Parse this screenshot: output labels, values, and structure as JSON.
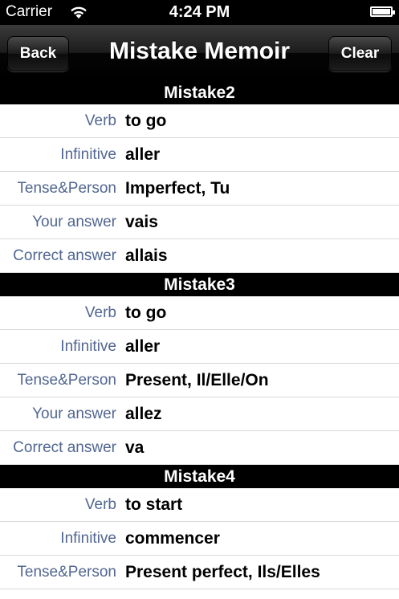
{
  "status_bar": {
    "carrier": "Carrier",
    "time": "4:24 PM"
  },
  "navbar": {
    "back_label": "Back",
    "title": "Mistake Memoir",
    "clear_label": "Clear"
  },
  "sections": [
    {
      "title": "Mistake2",
      "rows": [
        {
          "label": "Verb",
          "value": "to go"
        },
        {
          "label": "Infinitive",
          "value": "aller"
        },
        {
          "label": "Tense&Person",
          "value": "Imperfect, Tu"
        },
        {
          "label": "Your answer",
          "value": "vais"
        },
        {
          "label": "Correct answer",
          "value": "allais"
        }
      ]
    },
    {
      "title": "Mistake3",
      "rows": [
        {
          "label": "Verb",
          "value": "to go"
        },
        {
          "label": "Infinitive",
          "value": "aller"
        },
        {
          "label": "Tense&Person",
          "value": "Present, Il/Elle/On"
        },
        {
          "label": "Your answer",
          "value": "allez"
        },
        {
          "label": "Correct answer",
          "value": "va"
        }
      ]
    },
    {
      "title": "Mistake4",
      "rows": [
        {
          "label": "Verb",
          "value": "to start"
        },
        {
          "label": "Infinitive",
          "value": "commencer"
        },
        {
          "label": "Tense&Person",
          "value": "Present perfect, Ils/Elles"
        }
      ]
    }
  ]
}
